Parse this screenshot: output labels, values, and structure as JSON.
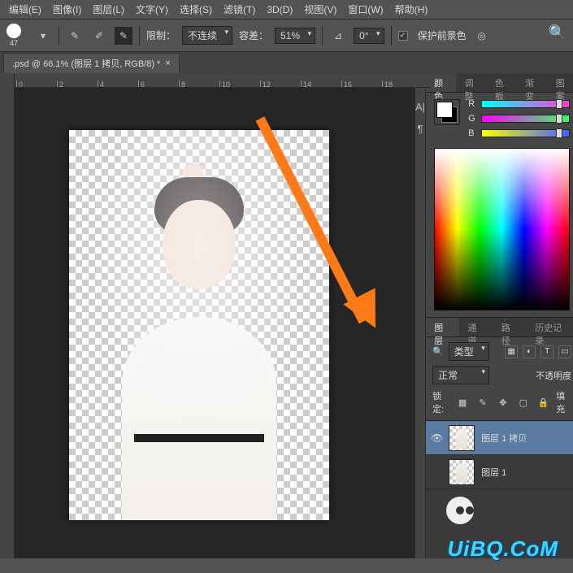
{
  "menu": {
    "edit": "编辑(E)",
    "image": "图像(I)",
    "layer": "图层(L)",
    "text": "文字(Y)",
    "select": "选择(S)",
    "filter": "滤镜(T)",
    "threeD": "3D(D)",
    "view": "视图(V)",
    "window": "窗口(W)",
    "help": "帮助(H)"
  },
  "options": {
    "brush_size": "47",
    "limit_label": "限制：",
    "limit_value": "不连续",
    "tolerance_label": "容差：",
    "tolerance_value": "51%",
    "angle_icon": "⊿",
    "angle_value": "0°",
    "protect_fg": "保护前景色",
    "protect_checked": "✓"
  },
  "doc": {
    "tab_title": ".psd @ 66.1% (图层 1 拷贝, RGB/8) *"
  },
  "ruler": {
    "t0": "0",
    "t2": "2",
    "t4": "4",
    "t6": "6",
    "t8": "8",
    "t10": "10",
    "t12": "12",
    "t14": "14",
    "t16": "16",
    "t18": "18"
  },
  "midtabs": {
    "a": "⫴",
    "b": "A|",
    "c": "¶"
  },
  "color_panel": {
    "tabs": {
      "color": "颜色",
      "adjust": "调整",
      "swatch": "色板",
      "grad": "渐变",
      "more": "图案"
    },
    "ch_r": "R",
    "ch_g": "G",
    "ch_b": "B"
  },
  "layer_panel": {
    "tabs": {
      "layers": "图层",
      "channels": "通道",
      "paths": "路径",
      "history": "历史记录"
    },
    "filter_label": "类型",
    "blend_mode": "正常",
    "opacity_label": "不透明度",
    "lock_label": "锁定:",
    "fill_label": "填充",
    "layers": [
      {
        "name": "图层 1 拷贝",
        "visible": "👁"
      },
      {
        "name": "图层 1",
        "visible": ""
      }
    ]
  },
  "watermark": "UiBQ.CoM"
}
